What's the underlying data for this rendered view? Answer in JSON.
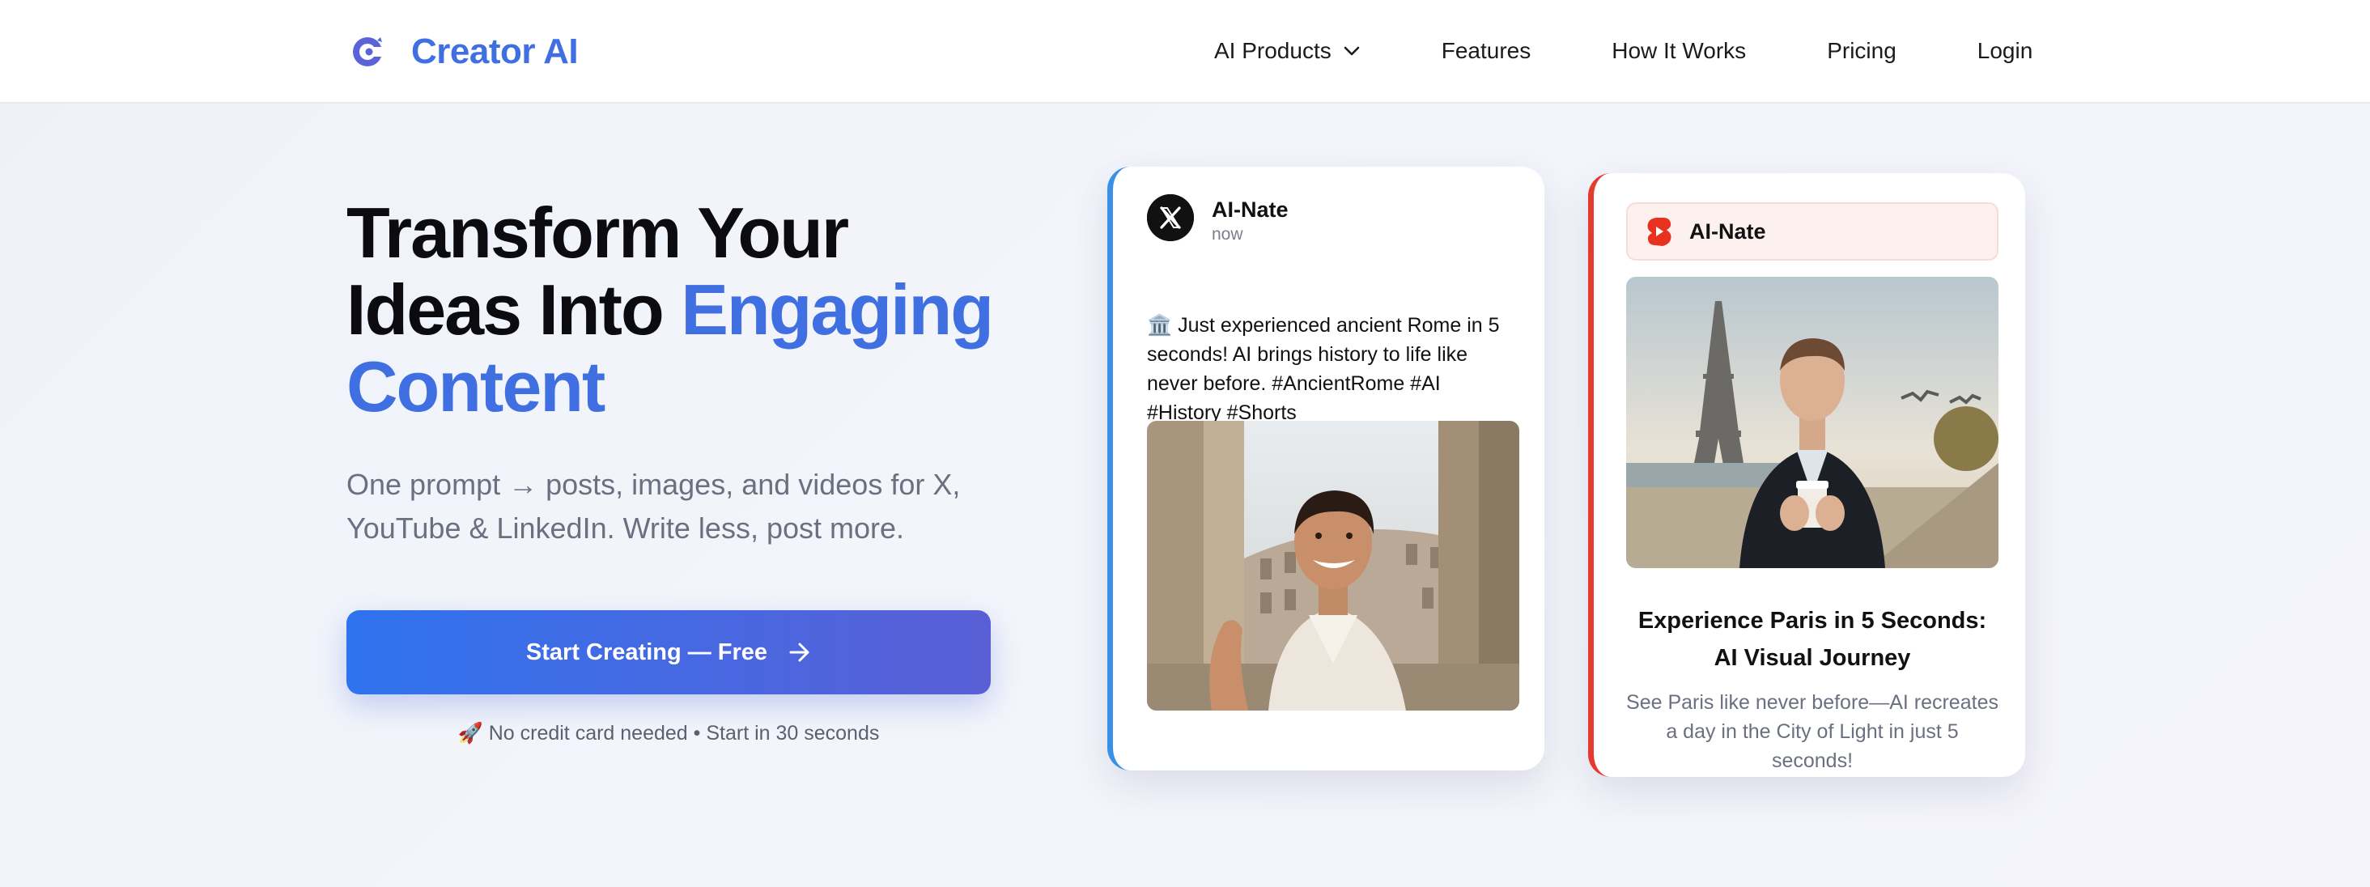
{
  "brand": {
    "name": "Creator AI",
    "logo": "creator-ai-logo-icon",
    "color": "#3f6fe0"
  },
  "nav": {
    "items": [
      {
        "label": "AI Products",
        "has_dropdown": true
      },
      {
        "label": "Features"
      },
      {
        "label": "How It Works"
      },
      {
        "label": "Pricing"
      },
      {
        "label": "Login"
      }
    ]
  },
  "hero": {
    "title_line1": "Transform Your",
    "title_line2_plain": "Ideas Into ",
    "title_line2_accent": "Engaging",
    "title_line3_accent": "Content",
    "subtitle": "One prompt → posts, images, and videos for X, YouTube & LinkedIn. Write less, post more.",
    "cta_label": "Start Creating — Free",
    "cta_icon": "arrow-right-icon",
    "note": "🚀 No credit card needed • Start in 30 seconds"
  },
  "cards": {
    "x_post": {
      "platform_icon": "x-logo-icon",
      "author": "AI-Nate",
      "time": "now",
      "text": "🏛️ Just experienced ancient Rome in 5 seconds! AI brings history to life like never before. #AncientRome #AI #History #Shorts",
      "image": "man-in-toga-at-colosseum-photo",
      "accent": "#3b8fe6"
    },
    "youtube_short": {
      "platform_icon": "youtube-shorts-icon",
      "author": "AI-Nate",
      "image": "man-with-coffee-at-eiffel-tower-photo",
      "title": "Experience Paris in 5 Seconds: AI Visual Journey",
      "description": "See Paris like never before—AI recreates a day in the City of Light in just 5 seconds!",
      "accent": "#e43a2f"
    }
  },
  "colors": {
    "accent": "#3f6fe0",
    "cta_gradient_start": "#2f73ee",
    "cta_gradient_end": "#5a5fd6"
  }
}
